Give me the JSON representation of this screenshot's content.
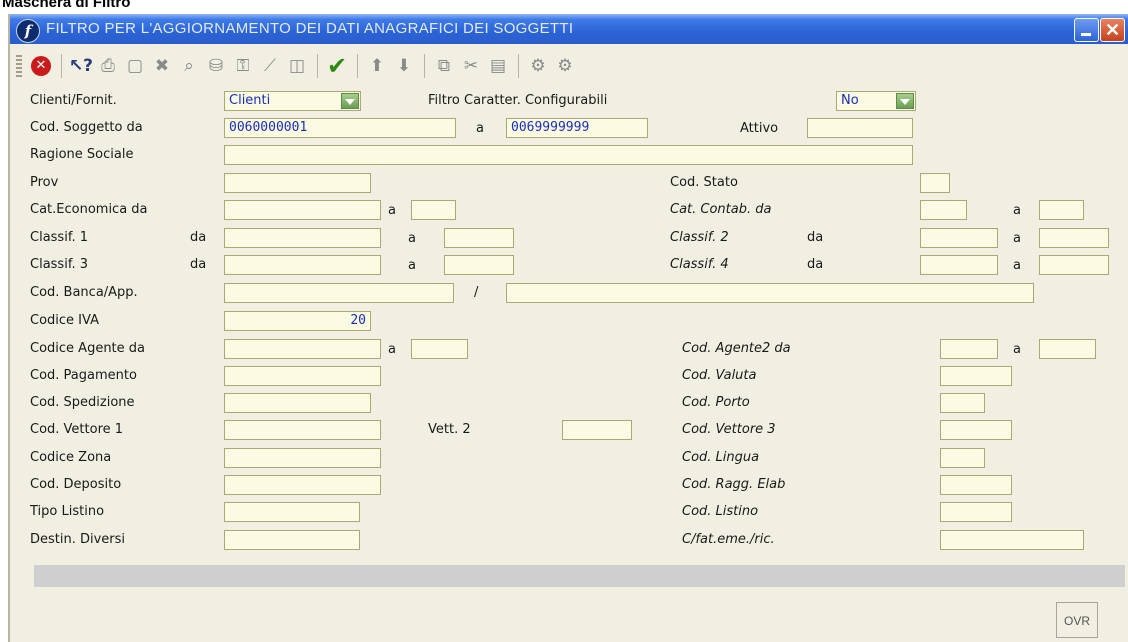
{
  "caption": "Maschera di Filtro",
  "window": {
    "title": "FILTRO PER L'AGGIORNAMENTO DEI DATI ANAGRAFICI DEI SOGGETTI"
  },
  "toolbar": {
    "icons": [
      "stop-icon",
      "help-pointer-icon",
      "print-icon",
      "new-document-icon",
      "delete-icon",
      "zoom-icon",
      "find-icon",
      "key-icon",
      "wand-icon",
      "columns-icon",
      "confirm-check-icon",
      "arrow-up-icon",
      "arrow-down-icon",
      "copy-icon",
      "cut-icon",
      "paste-icon",
      "gear-icon",
      "gear-alt-icon"
    ]
  },
  "form": {
    "clienti_fornit": {
      "label": "Clienti/Fornit.",
      "value": "Clienti"
    },
    "filtro_caratter": {
      "label": "Filtro Caratter. Configurabili",
      "value": "No"
    },
    "cod_soggetto": {
      "label": "Cod. Soggetto da",
      "from": "0060000001",
      "to_label": "a",
      "to": "0069999999"
    },
    "attivo": {
      "label": "Attivo",
      "value": ""
    },
    "ragione_sociale": {
      "label": "Ragione Sociale",
      "value": ""
    },
    "prov": {
      "label": "Prov",
      "value": ""
    },
    "cod_stato": {
      "label": "Cod. Stato",
      "value": ""
    },
    "cat_economica": {
      "label": "Cat.Economica da",
      "to_label": "a"
    },
    "cat_contab": {
      "label": "Cat. Contab. da",
      "to_label": "a"
    },
    "classif1": {
      "label": "Classif. 1",
      "da": "da",
      "to_label": "a"
    },
    "classif2": {
      "label": "Classif. 2",
      "da": "da",
      "to_label": "a"
    },
    "classif3": {
      "label": "Classif. 3",
      "da": "da",
      "to_label": "a"
    },
    "classif4": {
      "label": "Classif. 4",
      "da": "da",
      "to_label": "a"
    },
    "cod_banca": {
      "label": "Cod. Banca/App.",
      "sep": "/"
    },
    "codice_iva": {
      "label": "Codice IVA",
      "value": "20"
    },
    "codice_agente": {
      "label": "Codice Agente da",
      "to_label": "a"
    },
    "cod_agente2": {
      "label": "Cod. Agente2 da",
      "to_label": "a"
    },
    "cod_pagamento": {
      "label": "Cod. Pagamento"
    },
    "cod_valuta": {
      "label": "Cod. Valuta"
    },
    "cod_spedizione": {
      "label": "Cod. Spedizione"
    },
    "cod_porto": {
      "label": "Cod. Porto"
    },
    "cod_vettore1": {
      "label": "Cod. Vettore 1"
    },
    "vett2": {
      "label": "Vett. 2"
    },
    "cod_vettore3": {
      "label": "Cod. Vettore 3"
    },
    "codice_zona": {
      "label": "Codice Zona"
    },
    "cod_lingua": {
      "label": "Cod. Lingua"
    },
    "cod_deposito": {
      "label": "Cod. Deposito"
    },
    "cod_ragg_elab": {
      "label": "Cod. Ragg. Elab"
    },
    "tipo_listino": {
      "label": "Tipo Listino"
    },
    "cod_listino": {
      "label": "Cod. Listino"
    },
    "destin_diversi": {
      "label": "Destin. Diversi"
    },
    "cfat": {
      "label": "C/fat.eme./ric."
    }
  },
  "status": {
    "mode": "OVR"
  },
  "colors": {
    "title_bar": "#2b63d6",
    "form_bg": "#f1efe1",
    "field_bg": "#fbfbe4",
    "field_border": "#a5ab73",
    "value_text": "#1a2fb5"
  }
}
